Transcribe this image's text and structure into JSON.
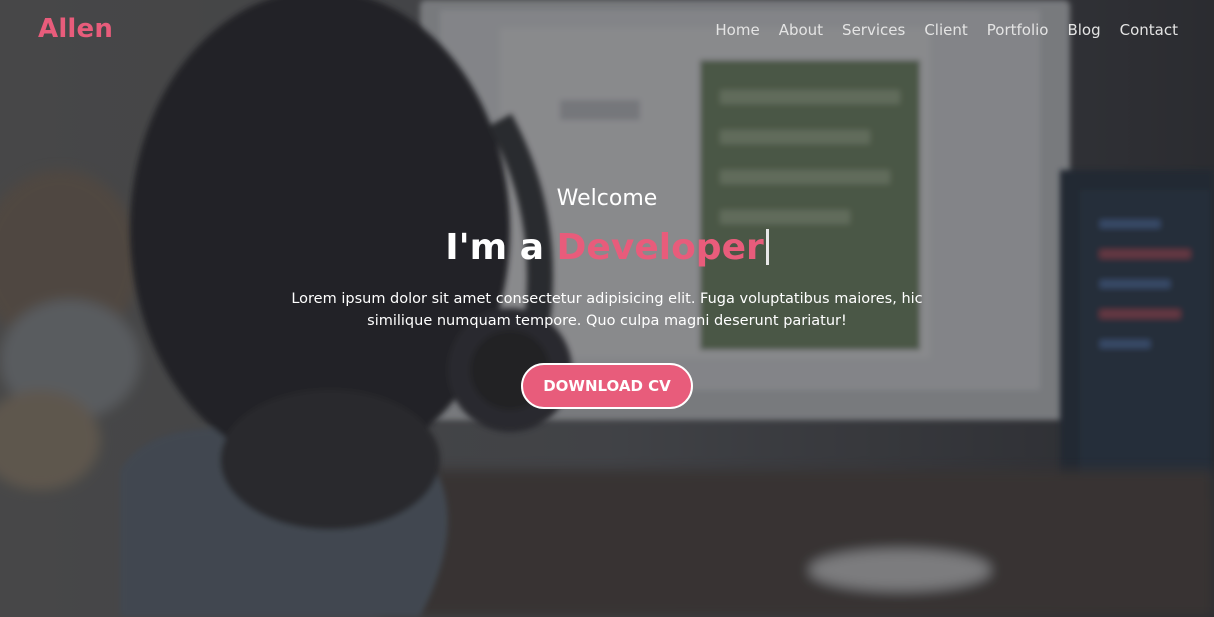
{
  "brand": {
    "name": "Allen"
  },
  "nav": {
    "items": [
      {
        "label": "Home"
      },
      {
        "label": "About"
      },
      {
        "label": "Services"
      },
      {
        "label": "Client"
      },
      {
        "label": "Portfolio"
      },
      {
        "label": "Blog"
      },
      {
        "label": "Contact"
      }
    ]
  },
  "hero": {
    "welcome": "Welcome",
    "headline_prefix": "I'm a",
    "headline_role": "Developer",
    "description": "Lorem ipsum dolor sit amet consectetur adipisicing elit. Fuga voluptatibus maiores, hic similique numquam tempore. Quo culpa magni deserunt pariatur!",
    "cta_label": "DOWNLOAD CV"
  },
  "colors": {
    "accent": "#e85c7b",
    "text": "#ffffff"
  }
}
